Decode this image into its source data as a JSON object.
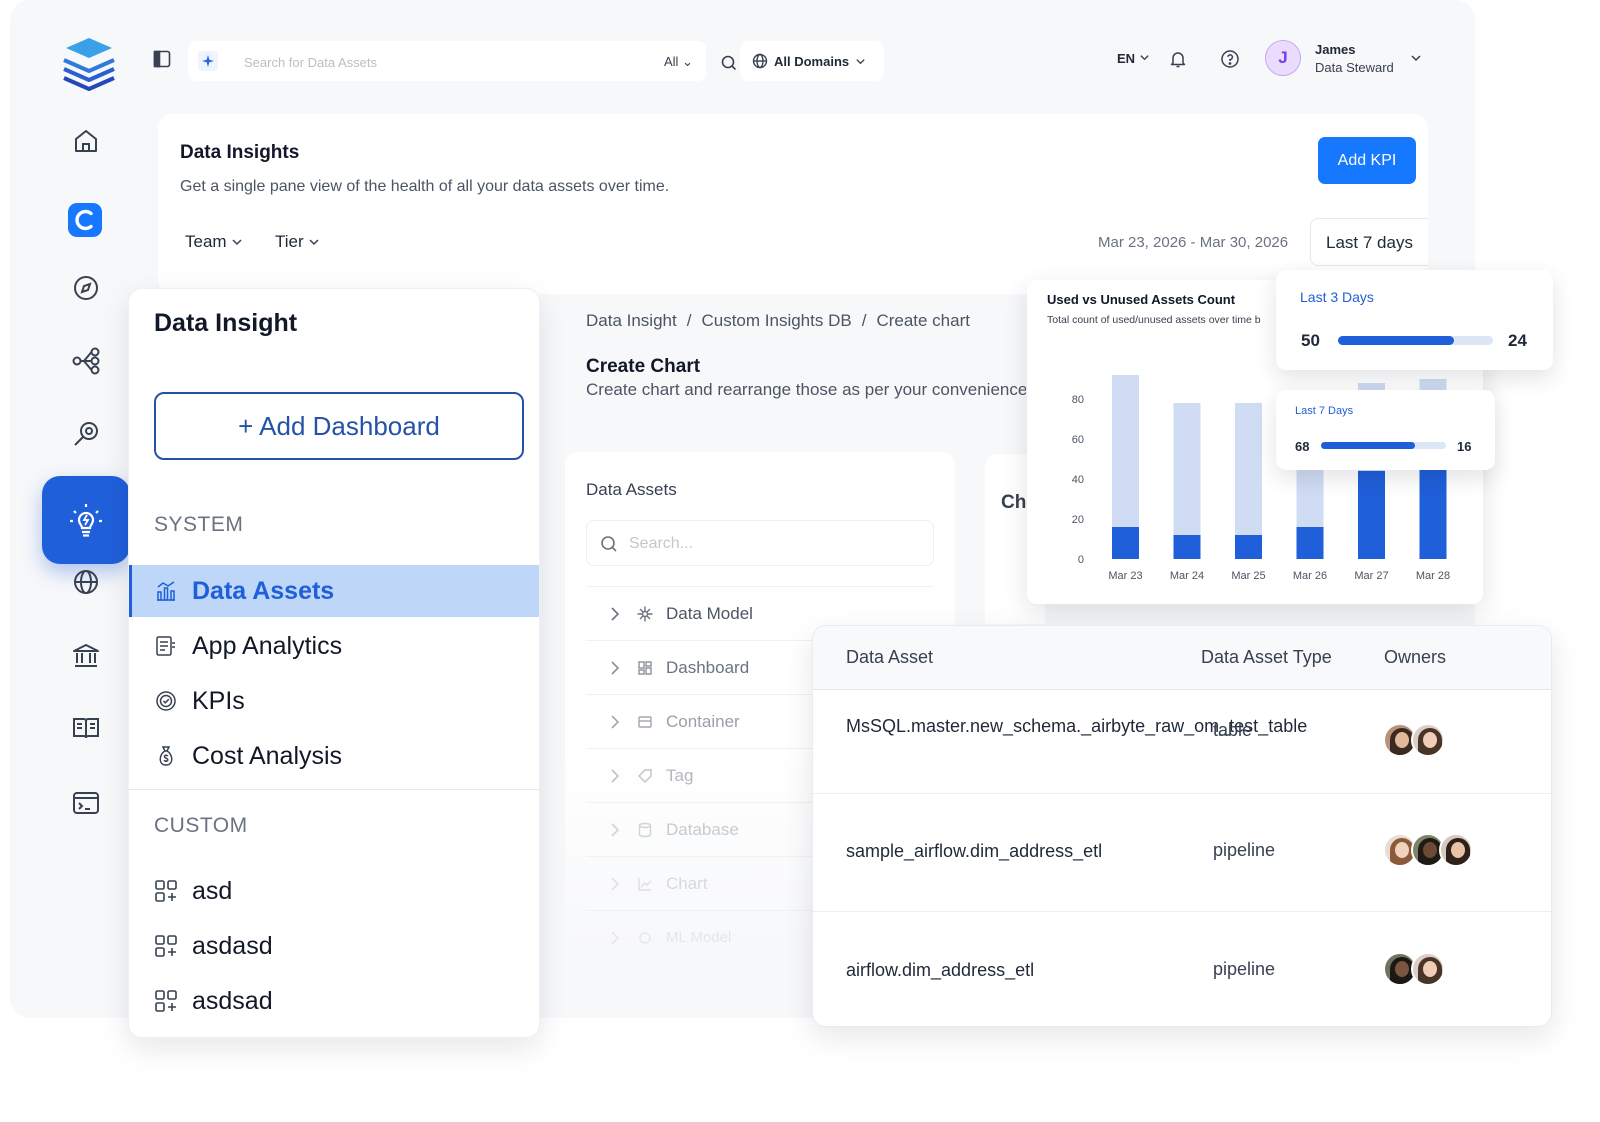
{
  "topbar": {
    "search_placeholder": "Search for Data Assets",
    "search_scope": "All",
    "domain": "All Domains",
    "language": "EN",
    "user_initial": "J",
    "user_name": "James",
    "user_role": "Data Steward"
  },
  "rail": {
    "items": [
      "home-icon",
      "collate-logo-icon",
      "explore-compass-icon",
      "lineage-icon",
      "observability-icon",
      "insights-bulb-icon",
      "domains-globe-icon",
      "governance-icon",
      "glossary-book-icon",
      "sql-terminal-icon"
    ],
    "active": "insights-bulb-icon"
  },
  "insights": {
    "title": "Data Insights",
    "description": "Get a single pane view of the health of all your data assets over time.",
    "add_kpi_label": "Add KPI",
    "filters": [
      "Team",
      "Tier"
    ],
    "date_range": "Mar 23, 2026  -  Mar 30, 2026",
    "period": "Last 7 days"
  },
  "side_panel": {
    "title": "Data Insight",
    "add_dashboard_label": "+ Add Dashboard",
    "system_label": "SYSTEM",
    "system_items": [
      {
        "label": "Data Assets",
        "icon": "data-assets-icon",
        "active": true
      },
      {
        "label": "App Analytics",
        "icon": "app-analytics-icon",
        "active": false
      },
      {
        "label": "KPIs",
        "icon": "kpi-icon",
        "active": false
      },
      {
        "label": "Cost Analysis",
        "icon": "cost-analysis-icon",
        "active": false
      }
    ],
    "custom_label": "CUSTOM",
    "custom_items": [
      "asd",
      "asdasd",
      "asdsad"
    ]
  },
  "create_chart": {
    "breadcrumb": [
      "Data Insight",
      "Custom Insights DB",
      "Create chart"
    ],
    "title": "Create Chart",
    "description": "Create chart and rearrange those as per your convenience",
    "assets_title": "Data Assets",
    "assets_search_placeholder": "Search...",
    "tree": [
      "Data Model",
      "Dashboard",
      "Container",
      "Tag",
      "Database",
      "Chart",
      "ML Model"
    ],
    "chart_card_heading": "Ch"
  },
  "chart_data": {
    "type": "bar",
    "title": "Used vs Unused Assets Count",
    "subtitle": "Total count of used/unused assets over time b",
    "categories": [
      "Mar 23",
      "Mar 24",
      "Mar 25",
      "Mar 26",
      "Mar 27",
      "Mar 28"
    ],
    "series": [
      {
        "color": "#1f5fd9",
        "values": [
          16,
          12,
          12,
          16,
          44,
          45
        ]
      },
      {
        "color": "#cfdcf3",
        "values": [
          76,
          66,
          66,
          64,
          44,
          45
        ]
      }
    ],
    "ylim": [
      0,
      80
    ],
    "yticks": [
      0,
      20,
      40,
      60,
      80
    ],
    "grid": false
  },
  "kpis": [
    {
      "label": "Last 3 Days",
      "left_value": "50",
      "right_value": "24",
      "progress": 0.75
    },
    {
      "label": "Last 7 Days",
      "left_value": "68",
      "right_value": "16",
      "progress": 0.75
    }
  ],
  "table": {
    "headers": [
      "Data Asset",
      "Data Asset Type",
      "Owners"
    ],
    "rows": [
      {
        "name": "MsSQL.master.new_schema._airbyte_raw_om_test_table",
        "type": "table",
        "owners": 2
      },
      {
        "name": "sample_airflow.dim_address_etl",
        "type": "pipeline",
        "owners": 3
      },
      {
        "name": "airflow.dim_address_etl",
        "type": "pipeline",
        "owners": 2
      }
    ]
  },
  "colors": {
    "accent": "#1f5fd9",
    "primary_button": "#1677ff",
    "active_row": "#bed6f8"
  }
}
